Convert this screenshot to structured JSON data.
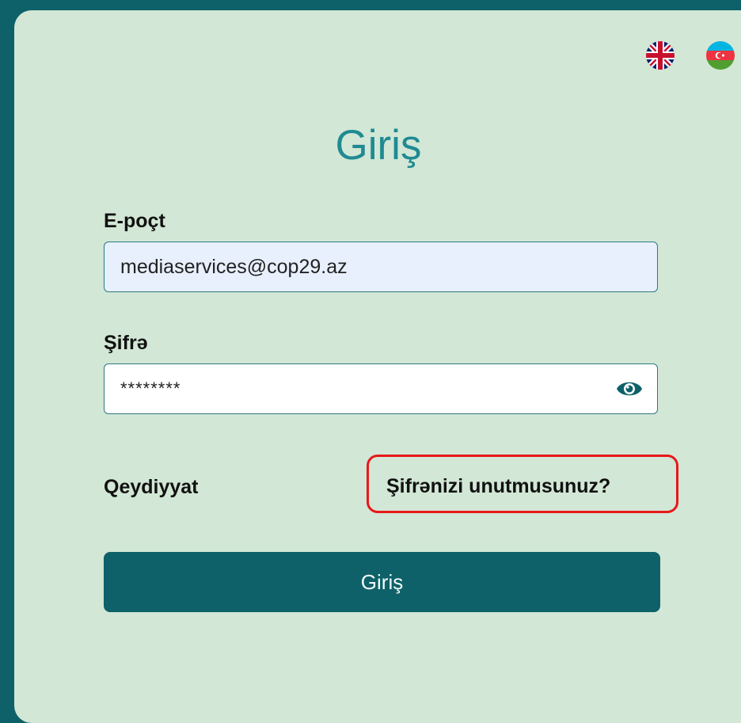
{
  "languages": [
    {
      "code": "en",
      "icon": "uk-flag-icon"
    },
    {
      "code": "az",
      "icon": "azerbaijan-flag-icon"
    }
  ],
  "form": {
    "title": "Giriş",
    "email_label": "E-poçt",
    "email_value": "mediaservices@cop29.az",
    "password_label": "Şifrə",
    "password_value": "********",
    "register_link": "Qeydiyyat",
    "forgot_link": "Şifrənizi unutmusunuz?",
    "submit_label": "Giriş"
  },
  "colors": {
    "background": "#0e6169",
    "card": "#d2e7d5",
    "accent": "#1f8a93",
    "button": "#0e6169",
    "highlight": "#e8171a"
  }
}
